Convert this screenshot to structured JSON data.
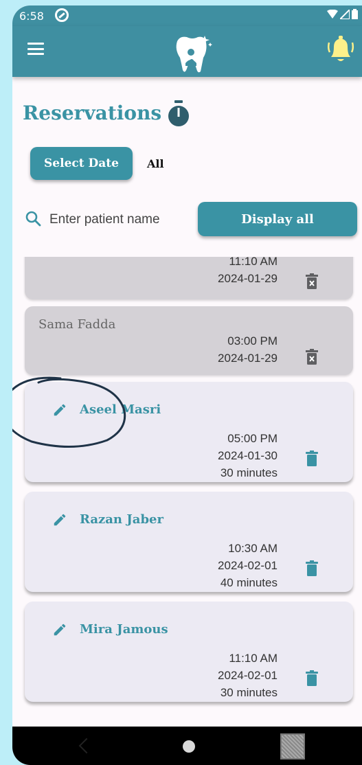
{
  "status_bar": {
    "time": "6:58"
  },
  "page": {
    "title": "Reservations",
    "select_date_label": "Select Date",
    "filter_label": "All",
    "search_placeholder": "Enter patient name",
    "display_all_label": "Display all"
  },
  "colors": {
    "primary": "#3f8fa1",
    "accent": "#3a93a4",
    "past_card": "#d4d1d6",
    "active_card": "#eceaf3"
  },
  "reservations": [
    {
      "name": "",
      "time": "11:10 AM",
      "date": "2024-01-29",
      "duration": "",
      "past": true
    },
    {
      "name": "Sama Fadda",
      "time": "03:00 PM",
      "date": "2024-01-29",
      "duration": "",
      "past": true
    },
    {
      "name": "Aseel Masri",
      "time": "05:00 PM",
      "date": "2024-01-30",
      "duration": "30 minutes",
      "past": false
    },
    {
      "name": "Razan Jaber",
      "time": "10:30 AM",
      "date": "2024-02-01",
      "duration": "40 minutes",
      "past": false
    },
    {
      "name": "Mira Jamous",
      "time": "11:10 AM",
      "date": "2024-02-01",
      "duration": "30 minutes",
      "past": false
    }
  ],
  "icons": [
    "menu-icon",
    "tooth-logo-icon",
    "bell-icon",
    "timer-icon",
    "search-icon",
    "edit-icon",
    "trash-icon"
  ]
}
